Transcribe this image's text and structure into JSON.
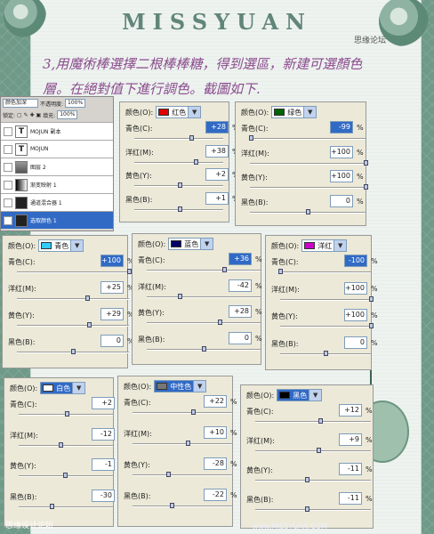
{
  "header": {
    "title": "MISSYUAN",
    "subtitle": "思缘论坛"
  },
  "intro_text": "3,用魔術棒選擇二根棒棒糖，得到選區，新建可選顏色層。在絕對值下進行調色。截圖如下.",
  "layers_panel": {
    "blend_mode": "颜色加深",
    "opacity_label": "不透明度:",
    "opacity_value": "100%",
    "lock_label": "锁定:",
    "fill_label": "填充:",
    "fill_value": "100%",
    "layers": [
      {
        "name": "MOJUN 副本",
        "thumb": "T",
        "type": "text"
      },
      {
        "name": "MOJUN",
        "thumb": "T",
        "type": "text"
      },
      {
        "name": "图层 2",
        "thumb": "",
        "type": "image"
      },
      {
        "name": "渐变映射 1",
        "thumb": "",
        "type": "gradient"
      },
      {
        "name": "通道混合器 1",
        "thumb": "",
        "type": "adjust"
      },
      {
        "name": "选取颜色 1",
        "thumb": "",
        "type": "adjust",
        "active": true
      }
    ]
  },
  "labels": {
    "color": "颜色(O):",
    "cyan": "青色(C):",
    "magenta": "洋红(M):",
    "yellow": "黄色(Y):",
    "black": "黑色(B):",
    "percent": "%"
  },
  "panels": [
    {
      "id": "red",
      "color_name": "红色",
      "swatch": "#e00000",
      "values": [
        "+28",
        "+38",
        "+2",
        "+1"
      ],
      "highlight": 0
    },
    {
      "id": "green",
      "color_name": "绿色",
      "swatch": "#006400",
      "values": [
        "-99",
        "+100",
        "+100",
        "0"
      ],
      "highlight": 0
    },
    {
      "id": "cyan",
      "color_name": "青色",
      "swatch": "#33ccff",
      "values": [
        "+100",
        "+25",
        "+29",
        "0"
      ],
      "highlight": 0
    },
    {
      "id": "blue",
      "color_name": "蓝色",
      "swatch": "#000066",
      "values": [
        "+36",
        "-42",
        "+28",
        "0"
      ],
      "highlight": 0
    },
    {
      "id": "magenta",
      "color_name": "洋红",
      "swatch": "#cc00cc",
      "values": [
        "-100",
        "+100",
        "+100",
        "0"
      ],
      "highlight": 0
    },
    {
      "id": "white",
      "color_name": "白色",
      "swatch": "#ffffff",
      "values": [
        "+2",
        "-12",
        "-1",
        "-30"
      ],
      "highlight": -1
    },
    {
      "id": "neutral",
      "color_name": "中性色",
      "swatch": "#777777",
      "values": [
        "+22",
        "+10",
        "-28",
        "-22"
      ],
      "highlight": -1
    },
    {
      "id": "black",
      "color_name": "黑色",
      "swatch": "#000000",
      "values": [
        "+12",
        "+9",
        "-11",
        "-11"
      ],
      "highlight": -1
    }
  ],
  "footer": {
    "left": "思缘设计论坛",
    "right": "www.MISSYUAN.COM"
  }
}
